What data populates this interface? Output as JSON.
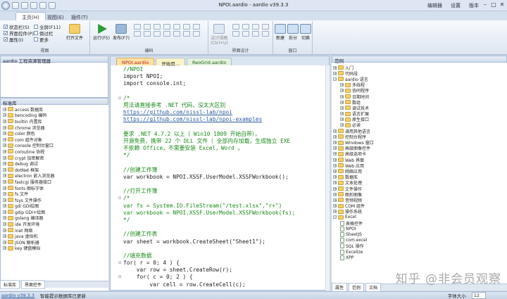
{
  "window": {
    "title": "NPOI.aardio - aardio v39.3.3",
    "right_menus": [
      "编辑器",
      "设置",
      "版本"
    ]
  },
  "ribbon_tabs": [
    "主页(H)",
    "视图(E)",
    "插件(T)"
  ],
  "ribbon": {
    "checks": [
      {
        "label": "状态栏(S)",
        "checked": true
      },
      {
        "label": "界面控件(P)",
        "checked": true
      },
      {
        "label": "属性(I)",
        "checked": true
      }
    ],
    "checks2": [
      "全屏(F11)",
      "倒过栏",
      "更多"
    ],
    "open_file": "打开文件",
    "groups": [
      "视图",
      "编码",
      "界面设计",
      "窗口"
    ],
    "run_btn": "运行(F5)",
    "publish_btn": "发布(F7)",
    "design_btn": "设计视图\n(Ctrl+U)",
    "new_btn": "新建",
    "split_btn": "拆分",
    "switch_btn": "切换"
  },
  "left": {
    "project_title": "aardio 工程资源管理器",
    "lib_title": "标准库",
    "libs": [
      "access 数据库",
      "bencoding 编码",
      "builtin 内置库",
      "chrome 浏览器",
      "color 颜色",
      "com 组件对象",
      "console 控制台窗口",
      "coroutine 协程",
      "crypt 加密解密",
      "debug 调试",
      "dotNet 框架",
      "electron 嵌入浏览器",
      "fastcgi 服务器接口",
      "fonts 图标字体",
      "fs 文件",
      "fsys 文件操作",
      "gdi GDI绘图",
      "gdip GDI+绘图",
      "golang 编译器",
      "ide 开发环境",
      "inet 网络",
      "java 虚拟机",
      "JSON 解析器",
      "key 键盘模拟"
    ],
    "bottom_tabs": [
      "标准库",
      "界面控件"
    ]
  },
  "editor": {
    "tabs": [
      "NPOI.aardio",
      "开始页...",
      "ReoGrid.aardio"
    ],
    "lines": [
      {
        "t": "//NPOI",
        "c": "cmt"
      },
      {
        "t": "import NPOI;",
        "c": "kw"
      },
      {
        "t": "import console.int;",
        "c": "kw"
      },
      {
        "t": "",
        "c": "kw"
      },
      {
        "t": "/*",
        "c": "cmt",
        "f": "⊟"
      },
      {
        "t": "用法请直接参考 .NET 代码，没太大区别",
        "c": "cmt"
      },
      {
        "t": "https://github.com/nissl-lab/npoi",
        "c": "lnk"
      },
      {
        "t": "https://github.com/nissl-lab/npoi-examples",
        "c": "lnk"
      },
      {
        "t": "",
        "c": "cmt"
      },
      {
        "t": "要求 .NET 4.7.2 以上（ Win10 1809 开始自带），",
        "c": "cmt"
      },
      {
        "t": "开源免费，携带 22 个 DLL 文件（ 全部内存加载，生成独立 EXE",
        "c": "cmt"
      },
      {
        "t": "不依赖 Office，不需要安装 Excel，Word 。",
        "c": "cmt"
      },
      {
        "t": "*/",
        "c": "cmt"
      },
      {
        "t": "",
        "c": "kw"
      },
      {
        "t": "//创建工作簿",
        "c": "cmt"
      },
      {
        "t": "var workbook = NPOI.XSSF.UserModel.XSSFWorkbook();",
        "c": "kw"
      },
      {
        "t": "",
        "c": "kw"
      },
      {
        "t": "//打开工作簿",
        "c": "cmt"
      },
      {
        "t": "/*",
        "c": "cmt",
        "f": "⊟"
      },
      {
        "t": "var fs = System.IO.FileStream(\"/test.xlsx\",\"r+\")",
        "c": "cmt"
      },
      {
        "t": "var workbook = NPOI.XSSF.UserModel.XSSFWorkbook(fs);",
        "c": "cmt"
      },
      {
        "t": "*/",
        "c": "cmt"
      },
      {
        "t": "",
        "c": "kw"
      },
      {
        "t": "//创建工作表",
        "c": "cmt"
      },
      {
        "t": "var sheet = workbook.CreateSheet(\"Sheet1\");",
        "c": "kw"
      },
      {
        "t": "",
        "c": "kw"
      },
      {
        "t": "//填充数据",
        "c": "cmt"
      },
      {
        "t": "for( r = 0; 4 ) {",
        "c": "kw",
        "f": "⊟"
      },
      {
        "t": "    var row = sheet.CreateRow(r);",
        "c": "kw"
      },
      {
        "t": "    for( c = 0; 2 ) {",
        "c": "kw",
        "f": "⊟"
      },
      {
        "t": "        var cell = row.CreateCell(c);",
        "c": "kw"
      }
    ]
  },
  "right": {
    "title": "范例",
    "items": [
      {
        "l": "入门",
        "d": 0,
        "k": "fold"
      },
      {
        "l": "代码段",
        "d": 0,
        "k": "fold"
      },
      {
        "l": "aardio 语言",
        "d": 0,
        "k": "fold",
        "pm": "−"
      },
      {
        "l": "多线程",
        "d": 1,
        "k": "fold"
      },
      {
        "l": "协同程序",
        "d": 1,
        "k": "fold"
      },
      {
        "l": "日期时间",
        "d": 1,
        "k": "fold"
      },
      {
        "l": "数组",
        "d": 1,
        "k": "fold"
      },
      {
        "l": "调试技术",
        "d": 1,
        "k": "fold"
      },
      {
        "l": "语言扩展",
        "d": 1,
        "k": "fold"
      },
      {
        "l": "原生接口",
        "d": 1,
        "k": "fold"
      },
      {
        "l": "必读",
        "d": 1,
        "k": "fold"
      },
      {
        "l": "调用其他语言",
        "d": 0,
        "k": "fold"
      },
      {
        "l": "控制台程序",
        "d": 0,
        "k": "fold"
      },
      {
        "l": "Windows 窗口",
        "d": 0,
        "k": "fold"
      },
      {
        "l": "高级图像控件",
        "d": 0,
        "k": "fold"
      },
      {
        "l": "高级选项卡",
        "d": 0,
        "k": "fold"
      },
      {
        "l": "Web 界面",
        "d": 0,
        "k": "fold"
      },
      {
        "l": "Web 应用",
        "d": 0,
        "k": "fold"
      },
      {
        "l": "网络应用",
        "d": 0,
        "k": "fold"
      },
      {
        "l": "数据库",
        "d": 0,
        "k": "fold"
      },
      {
        "l": "文本处理",
        "d": 0,
        "k": "fold"
      },
      {
        "l": "文件操作",
        "d": 0,
        "k": "fold"
      },
      {
        "l": "图形图像",
        "d": 0,
        "k": "fold"
      },
      {
        "l": "音频视频",
        "d": 0,
        "k": "fold"
      },
      {
        "l": "COM 组件",
        "d": 0,
        "k": "fold"
      },
      {
        "l": "操作系统",
        "d": 0,
        "k": "fold"
      },
      {
        "l": "Excel",
        "d": 0,
        "k": "fold",
        "pm": "−"
      },
      {
        "l": "表格控件",
        "d": 1,
        "k": "doc"
      },
      {
        "l": "NPOI",
        "d": 1,
        "k": "doc"
      },
      {
        "l": "SheetJS",
        "d": 1,
        "k": "doc"
      },
      {
        "l": "com.excel",
        "d": 1,
        "k": "doc"
      },
      {
        "l": "SQL 操作",
        "d": 1,
        "k": "doc"
      },
      {
        "l": "Excelize",
        "d": 1,
        "k": "doc"
      },
      {
        "l": "XPP",
        "d": 1,
        "k": "doc"
      }
    ],
    "bottom_tabs": [
      "属性",
      "范例",
      "文档"
    ]
  },
  "status": {
    "version": "aardio v39.3.3",
    "message": "智能提示数据库已更新",
    "font_label": "字体大小",
    "font_size": "12"
  },
  "watermark": "知乎 @非会员观察"
}
